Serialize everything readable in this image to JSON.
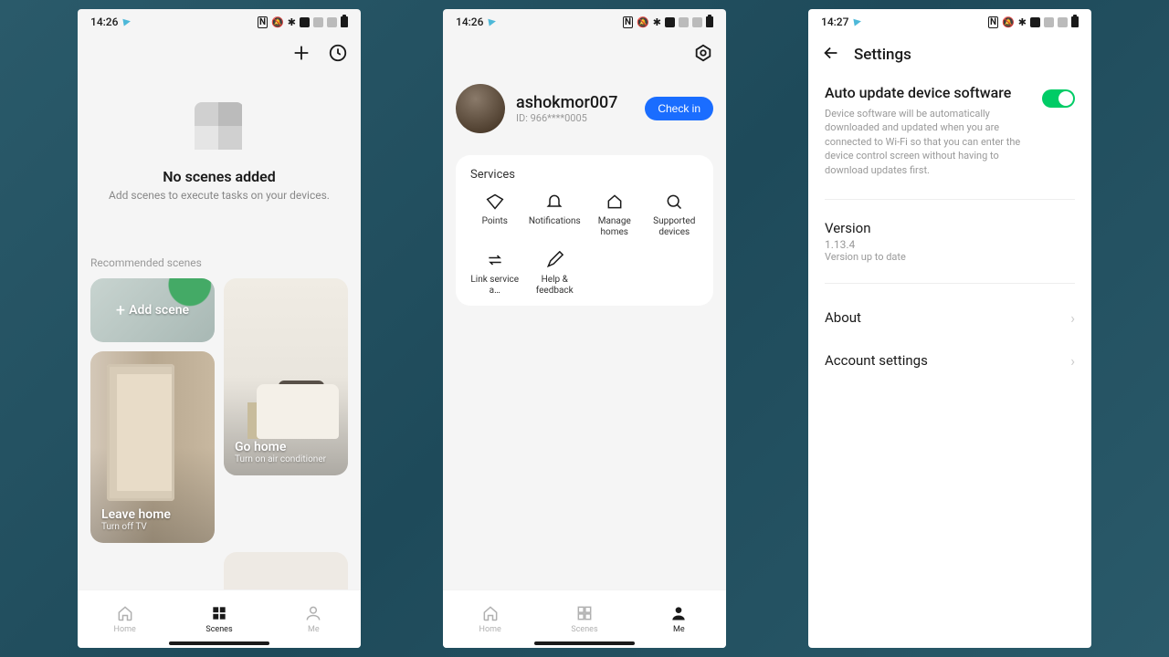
{
  "screen1": {
    "statusbar": {
      "time": "14:26"
    },
    "empty": {
      "title": "No scenes added",
      "subtitle": "Add scenes to execute tasks on your devices."
    },
    "recommended_label": "Recommended scenes",
    "cards": {
      "add_scene": "Add scene",
      "leave_home": {
        "title": "Leave home",
        "sub": "Turn off TV"
      },
      "go_home": {
        "title": "Go home",
        "sub": "Turn on air conditioner"
      }
    },
    "nav": {
      "home": "Home",
      "scenes": "Scenes",
      "me": "Me"
    }
  },
  "screen2": {
    "statusbar": {
      "time": "14:26"
    },
    "user": {
      "name": "ashokmor007",
      "id": "ID: 966****0005"
    },
    "checkin": "Check in",
    "services_title": "Services",
    "services": {
      "points": "Points",
      "notifications": "Notifications",
      "manage_homes": "Manage homes",
      "supported_devices": "Supported devices",
      "link_service": "Link service a…",
      "help_feedback": "Help & feedback"
    },
    "nav": {
      "home": "Home",
      "scenes": "Scenes",
      "me": "Me"
    }
  },
  "screen3": {
    "statusbar": {
      "time": "14:27"
    },
    "title": "Settings",
    "auto_update": {
      "title": "Auto update device software",
      "desc": "Device software will be automatically downloaded and updated when you are connected to Wi-Fi so that you can enter the device control screen without having to download updates first."
    },
    "version": {
      "label": "Version",
      "number": "1.13.4",
      "status": "Version up to date"
    },
    "about": "About",
    "account_settings": "Account settings"
  }
}
